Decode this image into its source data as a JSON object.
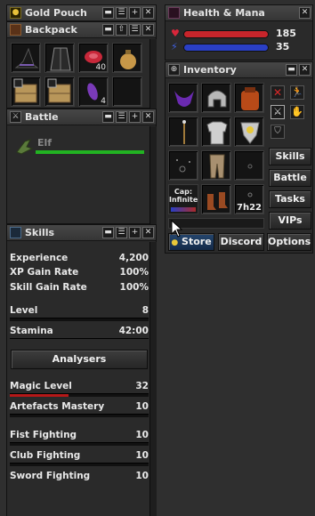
{
  "windows": {
    "gold_pouch": {
      "title": "Gold Pouch"
    },
    "backpack": {
      "title": "Backpack",
      "items": [
        {
          "name": "witch hat",
          "icon": "hat-icon",
          "count": ""
        },
        {
          "name": "coat",
          "icon": "coat-icon",
          "count": ""
        },
        {
          "name": "meat",
          "icon": "meat-icon",
          "count": "40"
        },
        {
          "name": "bag",
          "icon": "bag-icon",
          "count": ""
        },
        {
          "name": "box",
          "icon": "box-icon",
          "count": ""
        },
        {
          "name": "box",
          "icon": "box-icon",
          "count": ""
        },
        {
          "name": "violet gem",
          "icon": "gem-icon",
          "count": "4"
        },
        {
          "name": "empty",
          "icon": "",
          "count": ""
        }
      ]
    },
    "battle": {
      "title": "Battle",
      "creatures": [
        {
          "name": "Elf",
          "health_fraction": 1.0
        }
      ]
    },
    "skills": {
      "title": "Skills",
      "stats": [
        {
          "label": "Experience",
          "value": "4,200"
        },
        {
          "label": "XP Gain Rate",
          "value": "100%"
        },
        {
          "label": "Skill Gain Rate",
          "value": "100%"
        }
      ],
      "bars": [
        {
          "label": "Level",
          "value": "8",
          "progress": 0.0
        },
        {
          "label": "Stamina",
          "value": "42:00",
          "progress": 1.0
        }
      ],
      "analysers_label": "Analysers",
      "skill_list": [
        {
          "label": "Magic Level",
          "value": "32",
          "progress": 0.42,
          "color": "#b51818"
        },
        {
          "label": "Artefacts Mastery",
          "value": "10",
          "progress": 0.0,
          "color": "#b51818"
        },
        {
          "label": "Fist Fighting",
          "value": "10",
          "progress": 0.0,
          "color": "#b51818"
        },
        {
          "label": "Club Fighting",
          "value": "10",
          "progress": 0.0,
          "color": "#b51818"
        },
        {
          "label": "Sword Fighting",
          "value": "10",
          "progress": 0.0,
          "color": "#b51818"
        }
      ]
    },
    "health_mana": {
      "title": "Health & Mana",
      "health": 185,
      "mana": 35,
      "health_fraction": 1.0,
      "mana_fraction": 1.0,
      "health_color": "#c8252b",
      "mana_color": "#2a3fc4"
    },
    "inventory": {
      "title": "Inventory",
      "cap_label": "Cap:",
      "cap_value": "Infinite",
      "soul": "7h22",
      "side_buttons": [
        "Skills",
        "Battle",
        "Tasks",
        "VIPs"
      ],
      "bottom_buttons": [
        "Store",
        "Discord",
        "Options"
      ]
    }
  },
  "colors": {
    "panel_bg": "#2a2a2a",
    "title_bg": "#404040",
    "accent_green": "#22b322",
    "store_blue": "#1c3a66"
  }
}
